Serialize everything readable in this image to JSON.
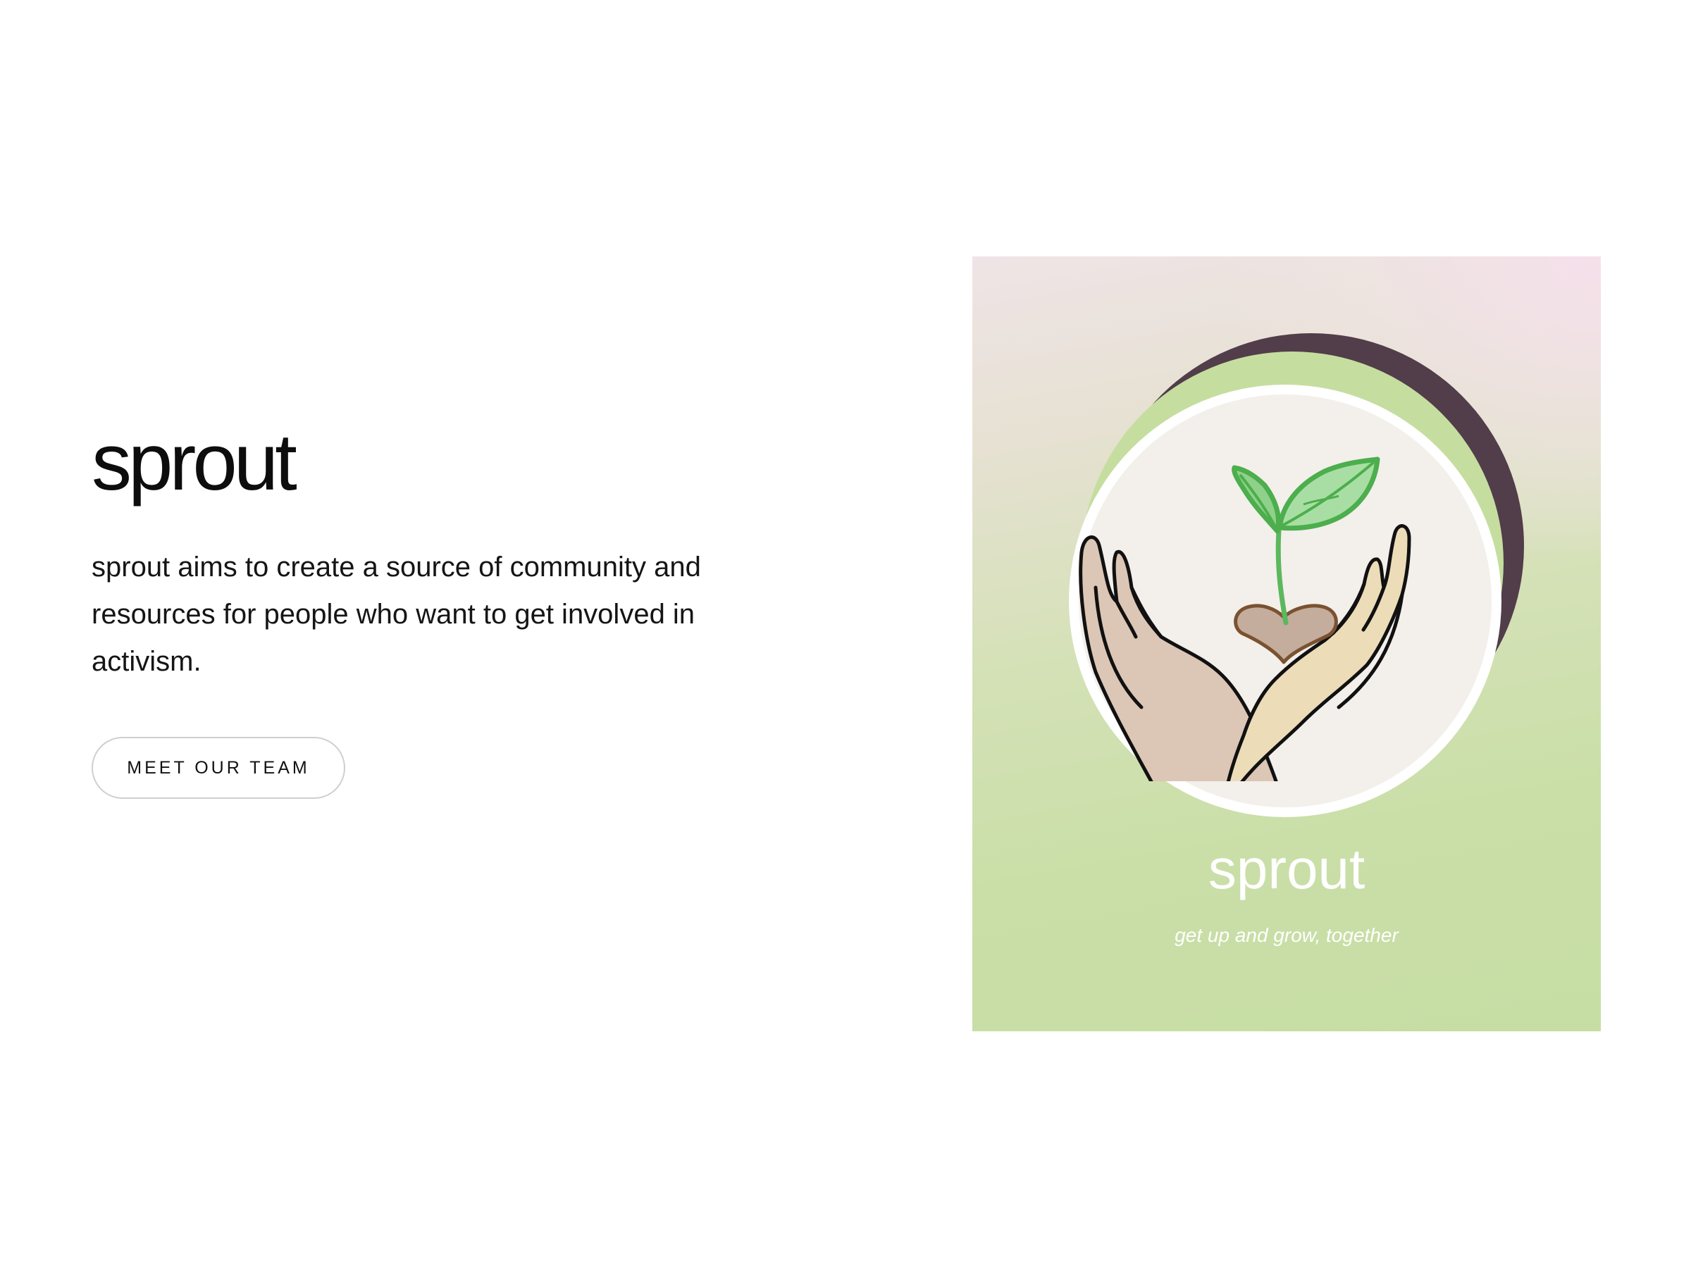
{
  "hero": {
    "title": "sprout",
    "description": "sprout aims to create a source of community and resources for people who want to get involved in activism.",
    "button_label": "MEET OUR TEAM"
  },
  "logo_card": {
    "brand_name": "sprout",
    "tagline": "get up and grow, together",
    "icons": [
      "sprout-icon",
      "hands-icon",
      "heart-seed-icon"
    ]
  },
  "colors": {
    "leaf_green": "#5cb85c",
    "crescent_plum": "#523d4a",
    "ring_green": "#c5de9f",
    "card_green": "#c8dfa8"
  }
}
